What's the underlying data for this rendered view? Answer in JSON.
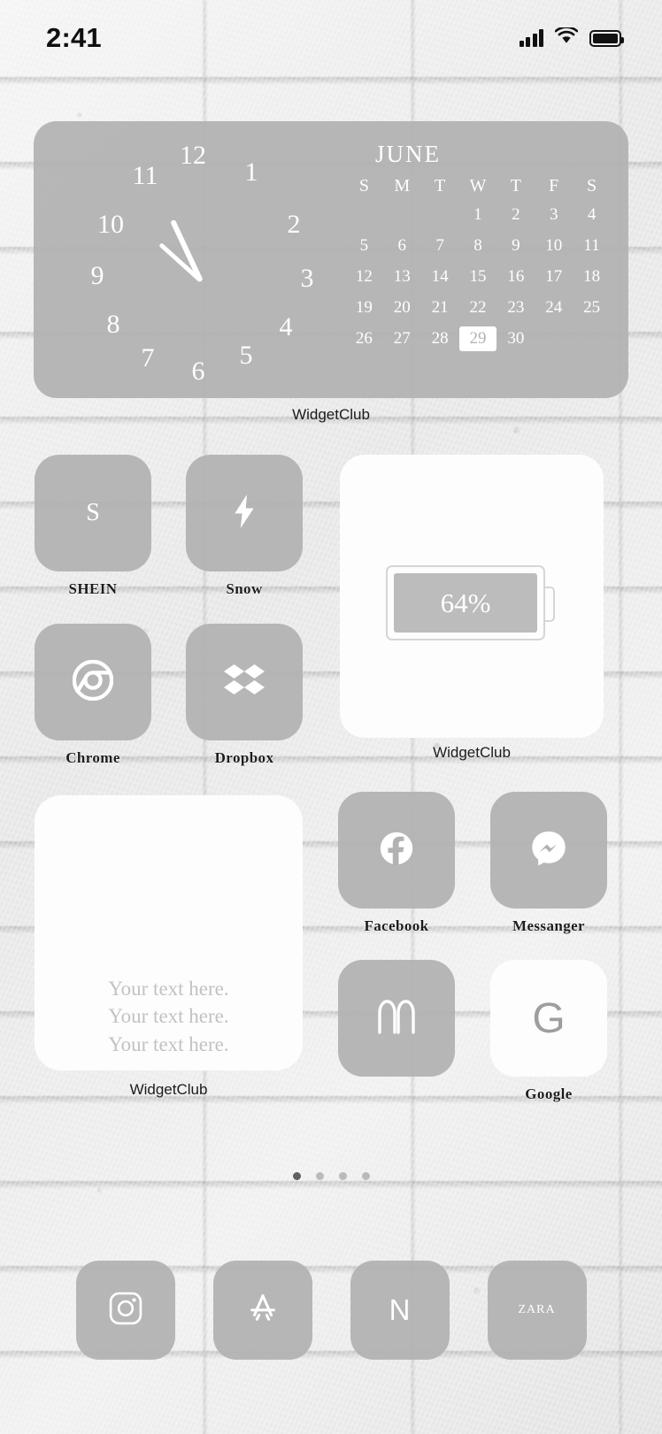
{
  "status_bar": {
    "time": "2:41",
    "signal_icon": "cellular-signal-icon",
    "wifi_icon": "wifi-icon",
    "battery_icon": "battery-icon"
  },
  "theme": {
    "icon_tint": "#b2b2b2",
    "glyph_color": "#ffffff",
    "widget_white": "#fdfdfd",
    "label_color": "#1b1b1b",
    "wallpaper": "white-brick-wall"
  },
  "clock_widget": {
    "caption": "WidgetClub",
    "numerals": [
      "1",
      "2",
      "3",
      "4",
      "5",
      "6",
      "7",
      "8",
      "9",
      "10",
      "11",
      "12"
    ],
    "hour_hand_angle": 245,
    "minute_hand_angle": 222
  },
  "calendar_widget": {
    "month": "JUNE",
    "weekday_headers": [
      "S",
      "M",
      "T",
      "W",
      "T",
      "F",
      "S"
    ],
    "leading_blanks": 3,
    "days": [
      1,
      2,
      3,
      4,
      5,
      6,
      7,
      8,
      9,
      10,
      11,
      12,
      13,
      14,
      15,
      16,
      17,
      18,
      19,
      20,
      21,
      22,
      23,
      24,
      25,
      26,
      27,
      28,
      29,
      30
    ],
    "today": 29
  },
  "apps": [
    {
      "label": "SHEIN",
      "icon": "shein-letter-icon",
      "glyph": "S",
      "tile": "gray"
    },
    {
      "label": "Snow",
      "icon": "lightning-bolt-icon",
      "glyph": "",
      "tile": "gray"
    },
    {
      "label": "Chrome",
      "icon": "chrome-icon",
      "glyph": "",
      "tile": "gray"
    },
    {
      "label": "Dropbox",
      "icon": "dropbox-icon",
      "glyph": "",
      "tile": "gray"
    },
    {
      "label": "Facebook",
      "icon": "facebook-icon",
      "glyph": "",
      "tile": "gray"
    },
    {
      "label": "Messanger",
      "icon": "messenger-icon",
      "glyph": "",
      "tile": "gray"
    },
    {
      "label": "",
      "icon": "mcdonalds-icon",
      "glyph": "",
      "tile": "gray"
    },
    {
      "label": "Google",
      "icon": "google-g-icon",
      "glyph": "G",
      "tile": "white"
    }
  ],
  "battery_widget": {
    "caption": "WidgetClub",
    "percent_label": "64%",
    "percent_value": 64
  },
  "note_widget": {
    "caption": "WidgetClub",
    "lines": [
      "Your text here.",
      "Your text here.",
      "Your text here."
    ]
  },
  "page_dots": {
    "count": 4,
    "active_index": 0
  },
  "dock": [
    {
      "name": "Instagram",
      "icon": "instagram-icon"
    },
    {
      "name": "App Store",
      "icon": "app-store-icon"
    },
    {
      "name": "Netflix",
      "icon": "netflix-icon",
      "glyph": "N"
    },
    {
      "name": "Zara",
      "icon": "zara-icon",
      "glyph": "ZARA"
    }
  ]
}
